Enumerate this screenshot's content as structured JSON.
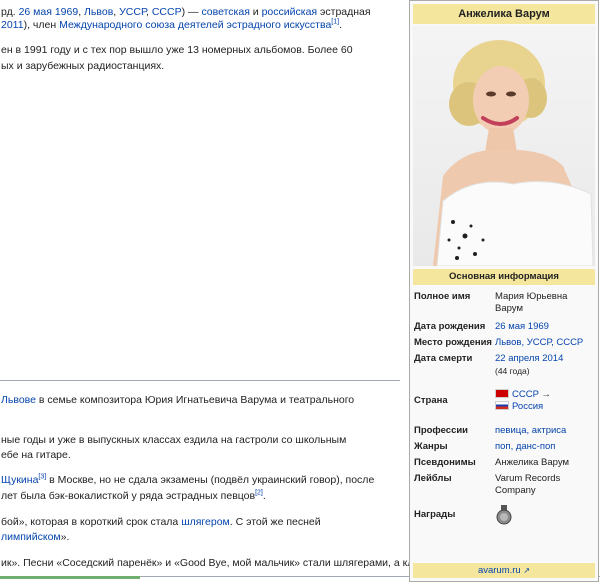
{
  "article": {
    "p1_l1": {
      "a": "рд. ",
      "date": "26 мая 1969",
      "b": ", ",
      "city": "Львов",
      "c": ", ",
      "country": "УССР",
      "d": ", ",
      "ussr": "СССР",
      "e": ") — ",
      "soviet": "советская",
      "f": " и ",
      "russian": "российская",
      "g": " эстрадная"
    },
    "p1_l2": {
      "year": "2011",
      "a": "), член ",
      "union": "Международного союза деятелей эстрадного искусства",
      "ref": "[1]",
      "b": "."
    },
    "p2_l1": "ен в 1991 году и с тех пор вышло уже 13 номерных альбомов. Более 60",
    "p2_l2": "ых и зарубежных радиостанциях.",
    "p3_l1": {
      "lviv": "Львове",
      "a": " в семье композитора Юрия Игнатьевича Варума и театрального"
    },
    "p4_l1": "ные годы и уже в выпускных классах ездила на гастроли со школьным",
    "p4_l2": "ебе на гитаре.",
    "p5_l1": {
      "shchukin": "Щукина",
      "ref": "[3]",
      "a": " в Москве, но не сдала экзамены (подвёл украинский говор), после"
    },
    "p5_l2": {
      "a": "лет была бэк-вокалисткой у ряда эстрадных певцов",
      "ref": "[2]",
      "b": "."
    },
    "p6_l1": {
      "a": "бой», которая в короткий срок стала ",
      "hit": "шлягером",
      "b": ". С этой же песней"
    },
    "p6_l2": {
      "olymp": "лимпийском",
      "a": "»."
    },
    "p7_l1": "ик». Песни «Соседский паренёк» и «Good Bye, мой мальчик» стали шлягерами, а клип на песню «Человек-"
  },
  "infobox": {
    "title": "Анжелика Варум",
    "section": "Основная информация",
    "rows": {
      "full_name": {
        "label": "Полное имя",
        "value": "Мария Юрьевна Варум"
      },
      "birth_date": {
        "label": "Дата рождения",
        "value": "26 мая 1969"
      },
      "birth_place": {
        "label": "Место рождения",
        "v1": "Львов",
        "sep1": ", ",
        "v2": "УССР",
        "sep2": ", ",
        "v3": "СССР"
      },
      "death_date": {
        "label": "Дата смерти",
        "value": "22 апреля 2014",
        "age": "(44 года)"
      },
      "country": {
        "label": "Страна",
        "v1": "СССР",
        "arrow": " →",
        "v2": "Россия"
      },
      "profession": {
        "label": "Профессии",
        "v1": "певица",
        "sep": ", ",
        "v2": "актриса"
      },
      "genres": {
        "label": "Жанры",
        "v1": "поп",
        "sep": ", ",
        "v2": "данс-поп"
      },
      "pseudonyms": {
        "label": "Псевдонимы",
        "value": "Анжелика Варум"
      },
      "labels": {
        "label": "Лейблы",
        "value": "Varum Records Company"
      },
      "awards": {
        "label": "Награды"
      }
    },
    "site": "avarum.ru"
  },
  "colors": {
    "link": "#0645ad",
    "infobox_header": "#f4e79d",
    "infobox_bg": "#f9f9f9",
    "flag_ussr": "#cc0000"
  }
}
